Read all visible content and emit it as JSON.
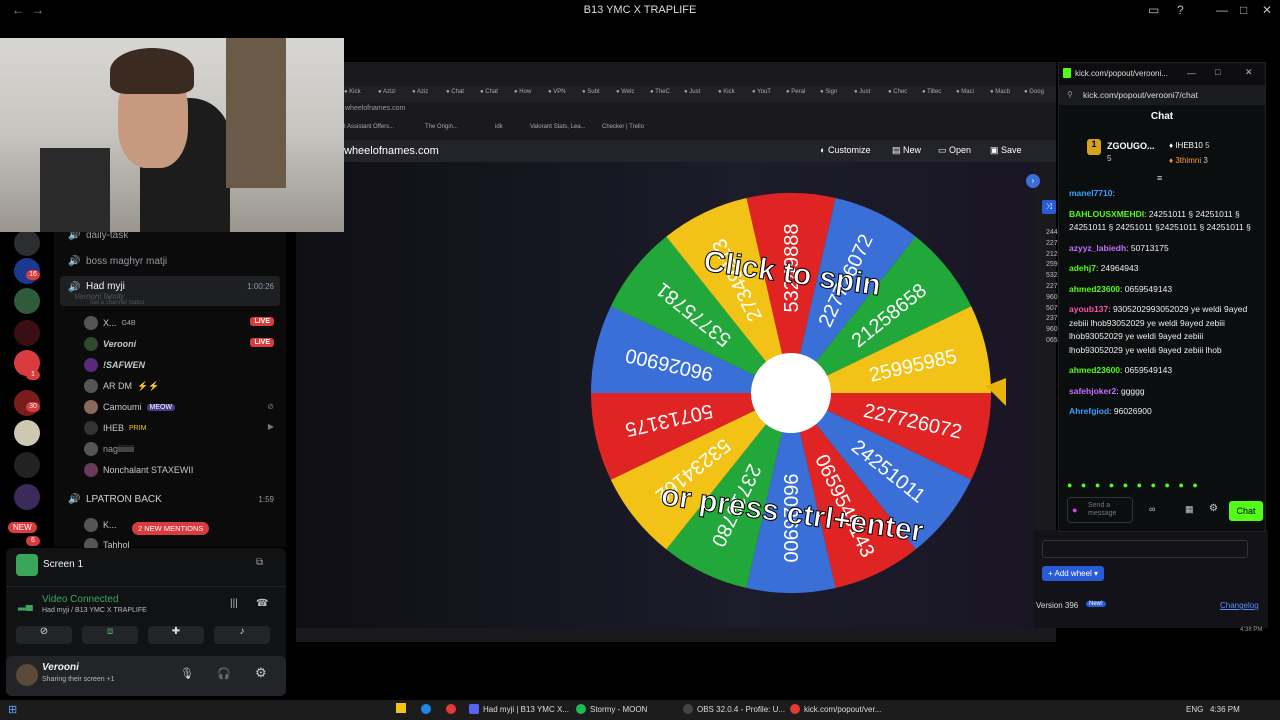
{
  "window": {
    "title": "B13 YMC X TRAPLIFE"
  },
  "discord": {
    "server_badges": [
      "16",
      "1",
      "30",
      "6"
    ],
    "new_badge": "NEW",
    "channels": {
      "daily_task": "daily-task",
      "boss": "boss maghyr matji",
      "had_myji": "Had myji",
      "had_myji_time": "1:00:26",
      "lpatron": "LPATRON BACK",
      "lpatron_time": "1:59",
      "mentions": "2 NEW MENTIONS"
    },
    "status_ghost": "Verooni family",
    "status_ghost_sub": "Set a channel status",
    "users": [
      {
        "name": "X...",
        "tag": "G4B",
        "live": "LIVE"
      },
      {
        "name": "Verooni",
        "live": "LIVE"
      },
      {
        "name": "!SAFWEN"
      },
      {
        "name": "AR DM"
      },
      {
        "name": "Camoumi",
        "tag": "MEOW"
      },
      {
        "name": "IHEB",
        "tag": "PRIM"
      },
      {
        "name": "nagiiiiiiii"
      },
      {
        "name": "Nonchalant STAXEWII"
      }
    ],
    "lp_users": [
      "K...",
      "Tahhol"
    ],
    "screen_label": "Screen 1",
    "voice_status": "Video Connected",
    "voice_channel": "Had myji / B13 YMC X TRAPLIFE",
    "me_name": "Verooni",
    "me_status": "Sharing their screen +1"
  },
  "browser": {
    "url": "wheelofnames.com",
    "tab_labels": [
      "Kick",
      "Azizi",
      "Aziz",
      "Chat",
      "Chat",
      "How",
      "VPN",
      "Subt",
      "Welc",
      "TheC",
      "Just",
      "Kick",
      "YouT",
      "Peral",
      "Sign",
      "Just",
      "Chec",
      "Tiltec",
      "Maci",
      "Macb",
      "Goog"
    ],
    "bookmarks": [
      "AI Assistant Offers...",
      "The Origin...",
      "idk",
      "Valorant Stats, Lea...",
      "Checker | Trello"
    ],
    "site": "wheelofnames.com",
    "toolbar": [
      "Customize",
      "New",
      "Open",
      "Save"
    ]
  },
  "wheel": {
    "overlay_top": "Click to spin",
    "overlay_bottom": "or press ctrl+enter",
    "slices": [
      {
        "label": "53249888",
        "color": "#e02424"
      },
      {
        "label": "227726072",
        "color": "#3a6fd8"
      },
      {
        "label": "21258658",
        "color": "#22a83a"
      },
      {
        "label": "25995985",
        "color": "#f2c316"
      },
      {
        "label": "227726072",
        "color": "#e02424"
      },
      {
        "label": "24251011",
        "color": "#3a6fd8"
      },
      {
        "label": "0659549143",
        "color": "#e02424"
      },
      {
        "label": "96026900",
        "color": "#3a6fd8"
      },
      {
        "label": "23715780",
        "color": "#22a83a"
      },
      {
        "label": "53234162",
        "color": "#f2c316"
      },
      {
        "label": "50713175",
        "color": "#e02424"
      },
      {
        "label": "96026900",
        "color": "#3a6fd8"
      },
      {
        "label": "53775781",
        "color": "#22a83a"
      },
      {
        "label": "27349213",
        "color": "#f2c316"
      }
    ]
  },
  "chat": {
    "window_url": "kick.com/popout/verooni...",
    "address": "kick.com/popout/verooni7/chat",
    "title": "Chat",
    "gifter_top": "ZGOUGO...",
    "gifter_top_count": "5",
    "gifter_2": "IHEB10",
    "gifter_2_count": "5",
    "gifter_3": "3thimni",
    "gifter_3_count": "3",
    "messages": [
      {
        "user": "manel7710",
        "text": "",
        "color": "#3aa0ff"
      },
      {
        "user": "BAHLOUSXMEHDI",
        "text": "24251011 § 24251011 § 24251011 § 24251011 §24251011 § 24251011 §",
        "color": "#53fc18"
      },
      {
        "user": "azyyz_labiedh",
        "text": "50713175",
        "color": "#c86cff"
      },
      {
        "user": "adehj7",
        "text": "24964943",
        "color": "#53fc18"
      },
      {
        "user": "ahmed23600",
        "text": "0659549143",
        "color": "#53fc18"
      },
      {
        "user": "ayoub137",
        "text": "9305202993052029 ye weldi 9ayed zebiii lhob93052029 ye weldi 9ayed zebiii lhob93052029 ye weldi 9ayed zebiii lhob93052029 ye weldi 9ayed zebiii lhob",
        "color": "#ff4fa8"
      },
      {
        "user": "ahmed23600",
        "text": "0659549143",
        "color": "#53fc18"
      },
      {
        "user": "safehjoker2",
        "text": "ggggg",
        "color": "#c86cff"
      },
      {
        "user": "Ahrefgiod",
        "text": "96026900",
        "color": "#3aa0ff"
      }
    ],
    "input_placeholder": "Send a message",
    "send_button": "Chat"
  },
  "side": {
    "entries_partial": [
      "244",
      "227",
      "212",
      "259",
      "532",
      "227",
      "960",
      "507",
      "237",
      "960",
      "065"
    ],
    "add_wheel": "Add wheel",
    "version": "Version 396",
    "new_badge": "New!",
    "changelog": "Changelog",
    "clock": "4:38 PM"
  },
  "taskbar": {
    "items": [
      "Had myji | B13 YMC X...",
      "Stormy - MOON",
      "OBS 32.0.4 - Profile: U...",
      "kick.com/popout/ver..."
    ],
    "lang": "ENG",
    "time": "4:36 PM"
  }
}
